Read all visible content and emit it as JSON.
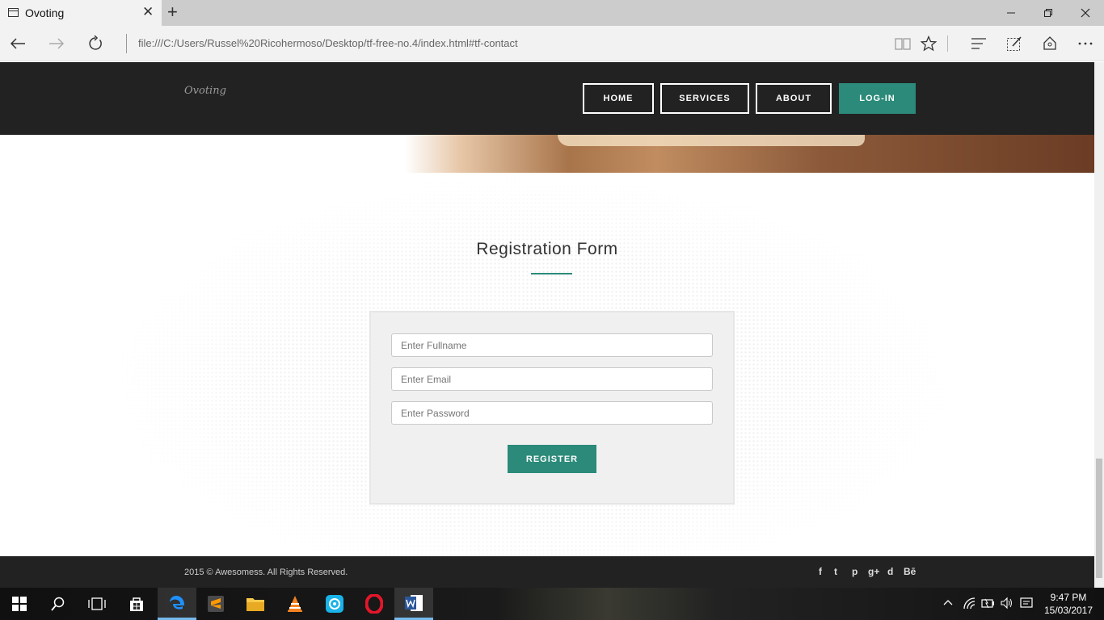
{
  "browser": {
    "tab_title": "Ovoting",
    "close_tab_glyph": "✕",
    "new_tab_glyph": "+",
    "url": "file:///C:/Users/Russel%20Ricohermoso/Desktop/tf-free-no.4/index.html#tf-contact",
    "window_controls": [
      "minimize-icon",
      "restore-icon",
      "close-icon"
    ],
    "toolbar_icons": [
      "reading-view-icon",
      "favorite-star-icon",
      "hub-icon",
      "web-note-icon",
      "share-icon",
      "more-icon"
    ]
  },
  "site": {
    "logo": "Ovoting",
    "nav": {
      "home": "HOME",
      "services": "SERVICES",
      "about": "ABOUT",
      "login": "LOG-IN"
    },
    "accent_color": "#2b8a79",
    "header_color": "#222222",
    "form": {
      "title": "Registration Form",
      "fullname_placeholder": "Enter Fullname",
      "email_placeholder": "Enter Email",
      "password_placeholder": "Enter Password",
      "register_label": "REGISTER"
    },
    "footer": {
      "copyright": "2015 © Awesomess. All Rights Reserved.",
      "social": [
        "f",
        "t",
        "p",
        "g+",
        "d",
        "Bē"
      ]
    }
  },
  "taskbar": {
    "apps": [
      "start-icon",
      "search-icon",
      "task-view-icon",
      "store-icon",
      "edge-icon",
      "sublime-icon",
      "file-explorer-icon",
      "vlc-icon",
      "shareit-icon",
      "opera-icon",
      "word-icon"
    ],
    "tray_icons": [
      "chevron-up-icon",
      "wifi-icon",
      "battery-icon",
      "volume-icon",
      "notifications-icon"
    ],
    "time": "9:47 PM",
    "date": "15/03/2017"
  }
}
